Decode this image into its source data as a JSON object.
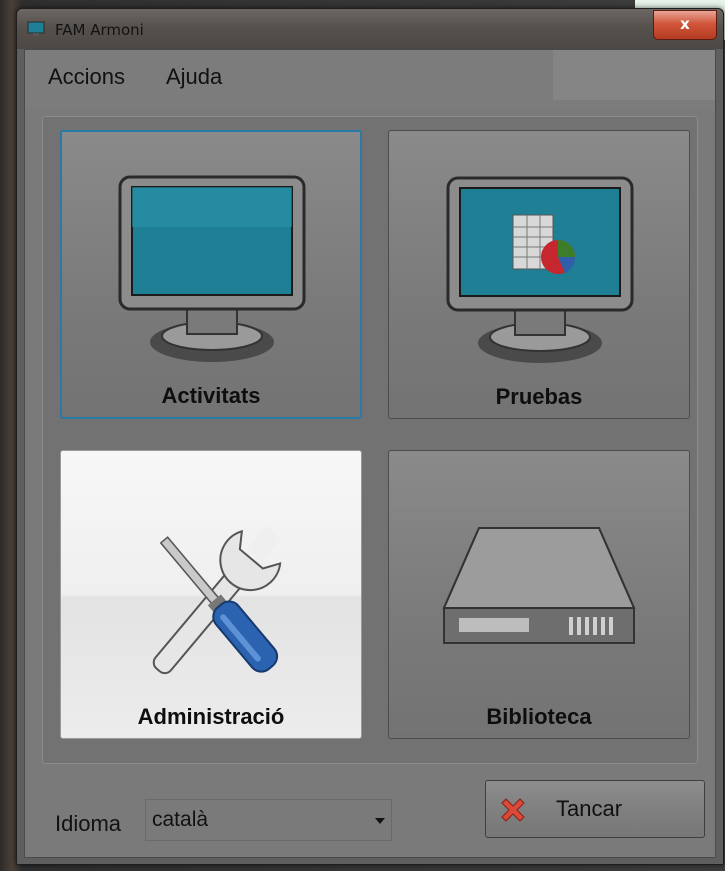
{
  "window": {
    "title": "FAM Armoni",
    "close_glyph": "x"
  },
  "menu": {
    "items": [
      {
        "label": "Accions"
      },
      {
        "label": "Ajuda"
      }
    ]
  },
  "tiles": [
    {
      "label": "Activitats",
      "icon": "monitor-icon",
      "state": "focused"
    },
    {
      "label": "Pruebas",
      "icon": "monitor-chart-icon",
      "state": "normal"
    },
    {
      "label": "Administració",
      "icon": "tools-icon",
      "state": "hover"
    },
    {
      "label": "Biblioteca",
      "icon": "hard-drive-icon",
      "state": "normal"
    }
  ],
  "footer": {
    "language_label": "Idioma",
    "language_value": "català",
    "close_button_label": "Tancar"
  },
  "colors": {
    "focus_border": "#2a7aa8",
    "screen": "#1f7f94",
    "close_red": "#d1563b"
  }
}
